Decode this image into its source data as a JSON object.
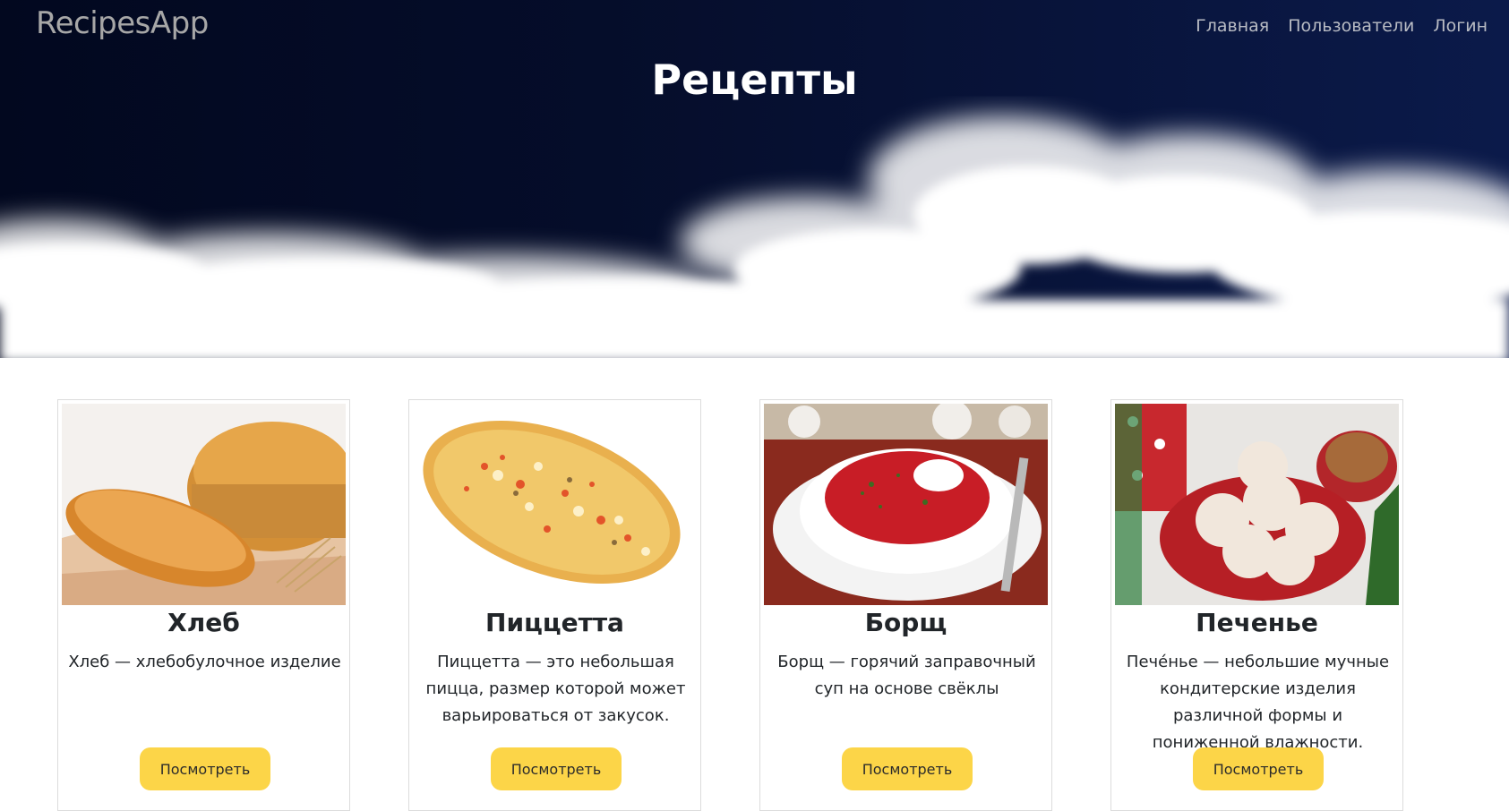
{
  "navbar": {
    "brand": "RecipesApp",
    "links": [
      "Главная",
      "Пользователи",
      "Логин"
    ]
  },
  "hero": {
    "title": "Рецепты"
  },
  "recipes": [
    {
      "title": "Хлеб",
      "description": "Хлеб — хлебобулочное изделие",
      "button": "Посмотреть",
      "image": "bread-image"
    },
    {
      "title": "Пиццетта",
      "description": "Пиццетта — это небольшая пицца, размер которой может варьироваться от закусок.",
      "button": "Посмотреть",
      "image": "pizzetta-image"
    },
    {
      "title": "Борщ",
      "description": "Борщ — горячий заправочный суп на основе свёклы",
      "button": "Посмотреть",
      "image": "borscht-image"
    },
    {
      "title": "Печенье",
      "description": "Печéнье — небольшие мучные кондитерские изделия различной формы и пониженной влажности.",
      "button": "Посмотреть",
      "image": "cookies-image"
    }
  ],
  "colors": {
    "hero_bg": "#050d2a",
    "button_bg": "#fcd548",
    "brand_text": "#a7a7a7"
  }
}
